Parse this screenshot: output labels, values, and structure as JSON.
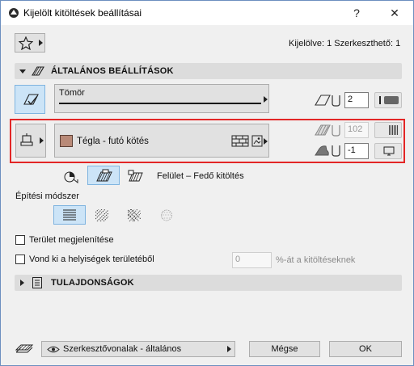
{
  "window": {
    "title": "Kijelölt kitöltések beállításai",
    "help_label": "?",
    "close_label": "✕"
  },
  "top": {
    "selection_status": "Kijelölve: 1 Szerkeszthető: 1"
  },
  "general": {
    "header": "ÁLTALÁNOS BEÁLLÍTÁSOK",
    "fill_type_name": "Tömör",
    "pen_value": "2"
  },
  "highlighted": {
    "fill_name": "Tégla - futó kötés",
    "fill_color": "#b98a78",
    "bg_pen_value": "102",
    "angle_value": "-1"
  },
  "surface": {
    "label": "Felület – Fedő kitöltés"
  },
  "method": {
    "label": "Építési módszer"
  },
  "options": {
    "show_area_label": "Terület megjelenítése",
    "subtract_label": "Vond ki a helyiségek területéből",
    "percent_value": "0",
    "percent_suffix": "%-át a kitöltéseknek"
  },
  "properties": {
    "header": "TULAJDONSÁGOK"
  },
  "footer": {
    "layer_value": "Szerkesztővonalak - általános",
    "cancel_label": "Mégse",
    "ok_label": "OK"
  }
}
